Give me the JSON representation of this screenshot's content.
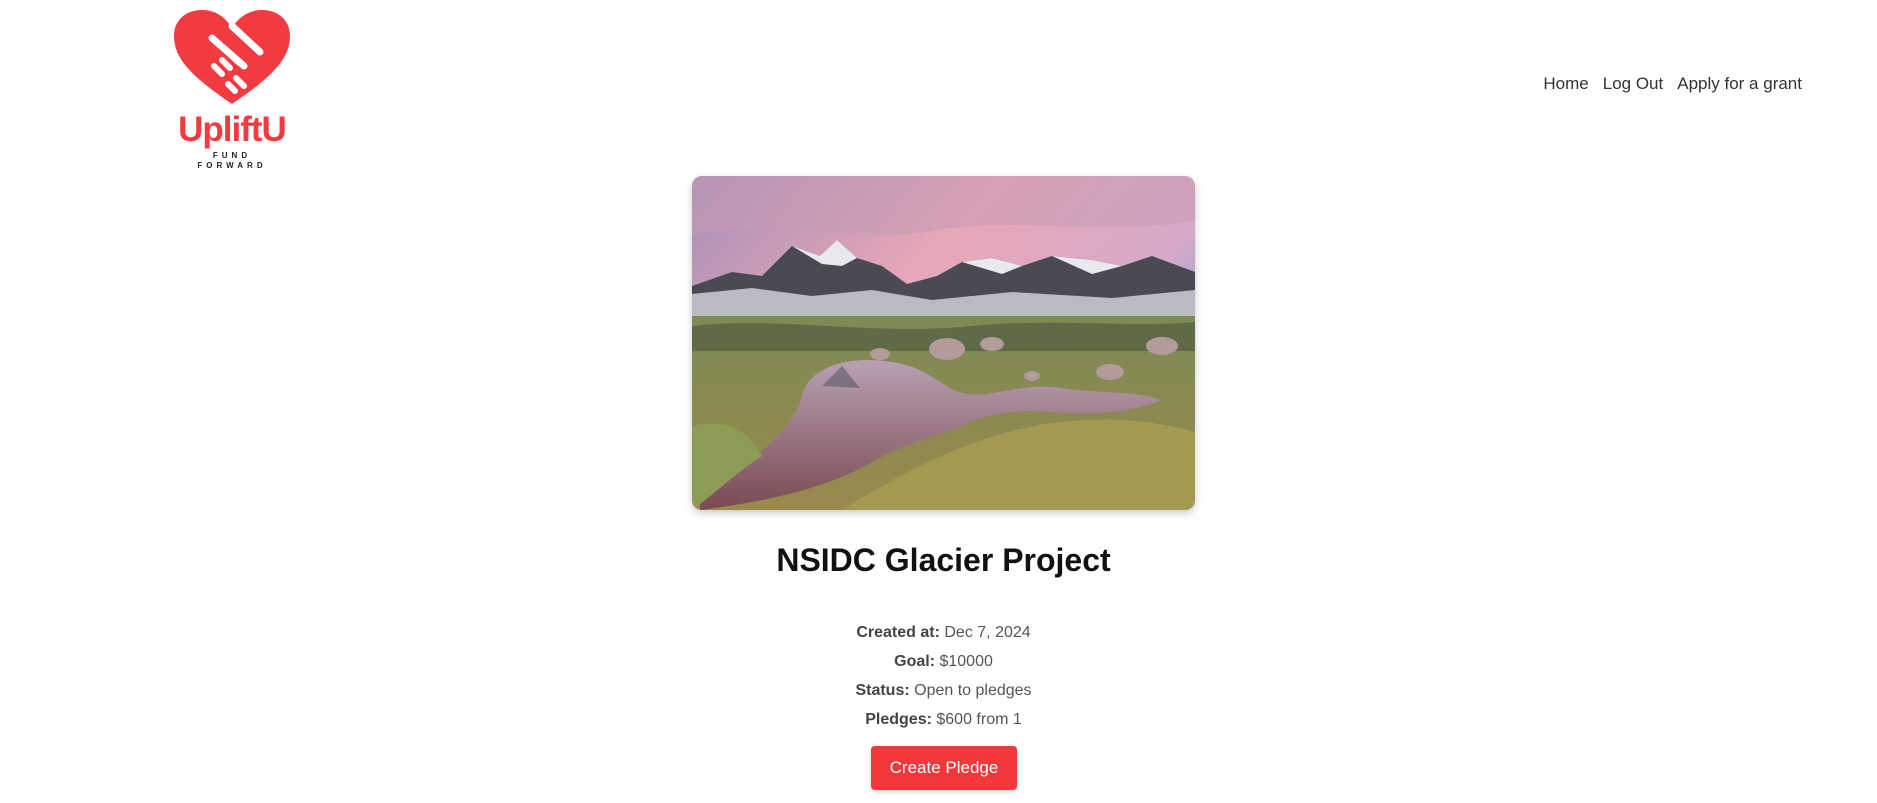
{
  "brand": {
    "name": "UpliftU",
    "tagline_line1": "FUND",
    "tagline_line2": "FORWARD",
    "color": "#f23b40",
    "icon": "heart-handshake-icon"
  },
  "nav": {
    "home": "Home",
    "logout": "Log Out",
    "apply": "Apply for a grant"
  },
  "project": {
    "image": "mountain-lake-photo",
    "title": "NSIDC Glacier Project",
    "details": [
      {
        "label": "Created at:",
        "value": "Dec 7, 2024"
      },
      {
        "label": "Goal:",
        "value": "$10000"
      },
      {
        "label": "Status:",
        "value": "Open to pledges"
      },
      {
        "label": "Pledges:",
        "value": "$600 from 1"
      }
    ]
  },
  "actions": {
    "create_pledge": "Create Pledge",
    "button_color": "#f2373d"
  }
}
